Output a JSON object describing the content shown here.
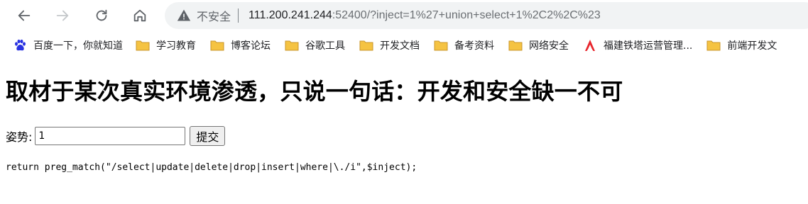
{
  "browser": {
    "security_label": "不安全",
    "url_host": "111.200.241.244",
    "url_rest": ":52400/?inject=1%27+union+select+1%2C2%2C%23"
  },
  "bookmarks": [
    {
      "label": "百度一下，你就知道",
      "icon": "baidu-paw-icon"
    },
    {
      "label": "学习教育",
      "icon": "folder-icon"
    },
    {
      "label": "博客论坛",
      "icon": "folder-icon"
    },
    {
      "label": "谷歌工具",
      "icon": "folder-icon"
    },
    {
      "label": "开发文档",
      "icon": "folder-icon"
    },
    {
      "label": "备考资料",
      "icon": "folder-icon"
    },
    {
      "label": "网络安全",
      "icon": "folder-icon"
    },
    {
      "label": "福建铁塔运营管理...",
      "icon": "tower-logo-icon"
    },
    {
      "label": "前端开发文",
      "icon": "folder-icon"
    }
  ],
  "page": {
    "title": "取材于某次真实环境渗透，只说一句话：开发和安全缺一不可",
    "input_label": "姿势:",
    "input_value": "1",
    "submit_label": "提交",
    "code": "return preg_match(\"/select|update|delete|drop|insert|where|\\./i\",$inject);"
  },
  "colors": {
    "folder": "#f5c342",
    "tower_logo": "#e8262d",
    "baidu": "#2932e1"
  }
}
